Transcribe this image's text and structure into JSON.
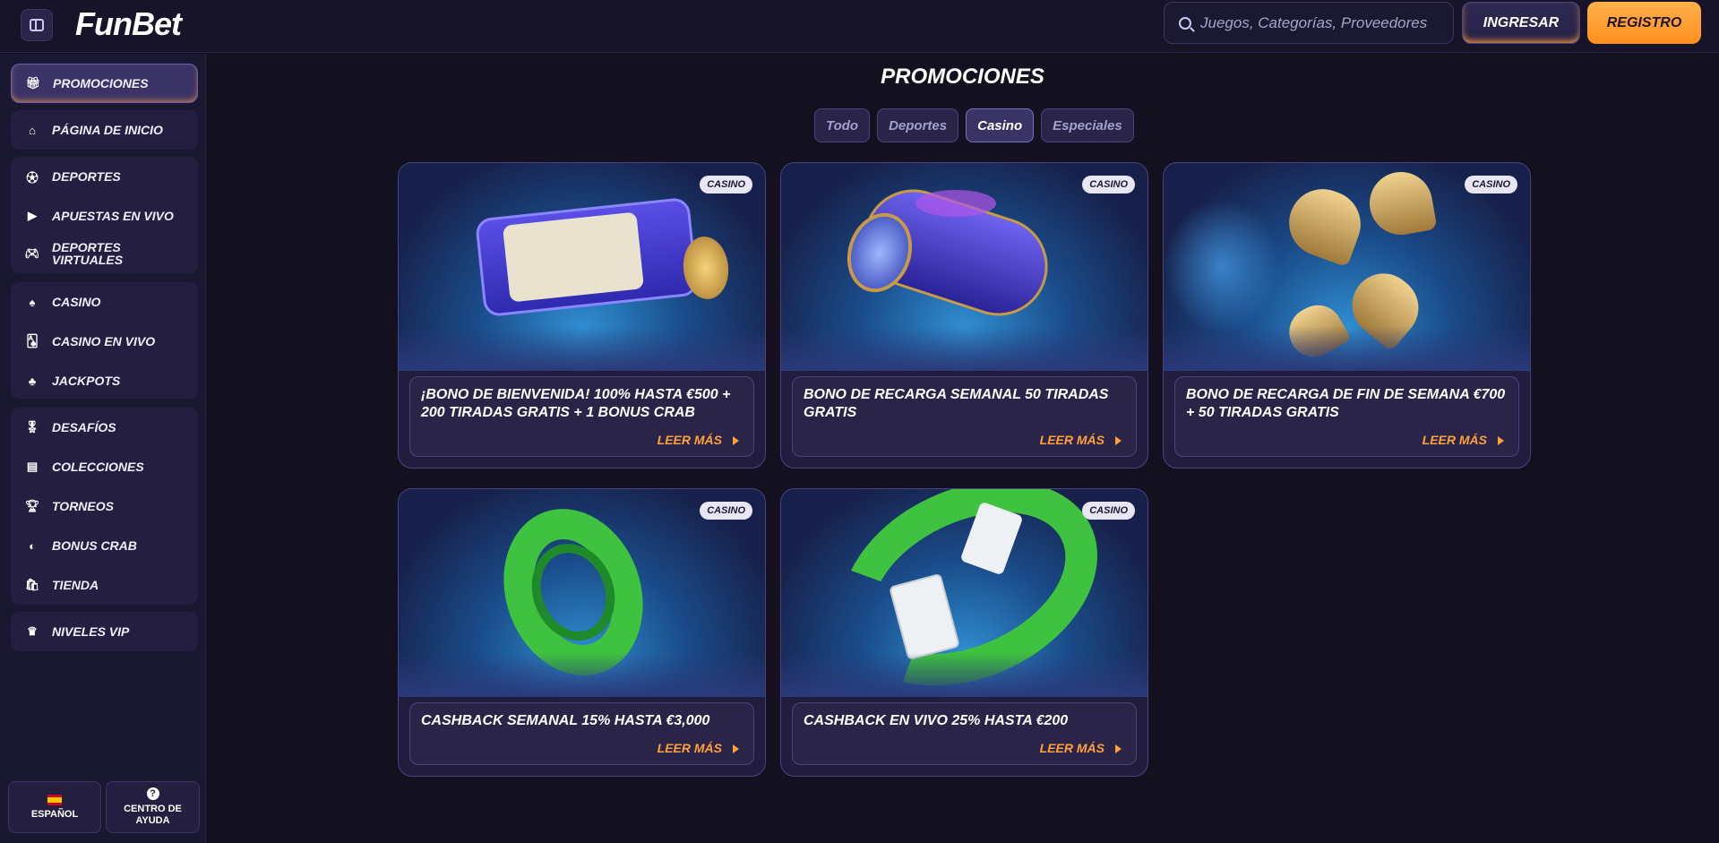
{
  "header": {
    "logo": "FunBet",
    "search_placeholder": "Juegos, Categorías, Proveedores",
    "login_label": "INGRESAR",
    "register_label": "REGISTRO"
  },
  "sidebar": {
    "items": [
      {
        "label": "PROMOCIONES",
        "icon": "gift-icon"
      },
      {
        "label": "PÁGINA DE INICIO",
        "icon": "home-icon"
      },
      {
        "label": "DEPORTES",
        "icon": "soccer-ball-icon"
      },
      {
        "label": "APUESTAS EN VIVO",
        "icon": "live-play-icon"
      },
      {
        "label": "DEPORTES VIRTUALES",
        "icon": "gamepad-icon"
      },
      {
        "label": "CASINO",
        "icon": "casino-icon"
      },
      {
        "label": "CASINO EN VIVO",
        "icon": "cards-icon"
      },
      {
        "label": "JACKPOTS",
        "icon": "clover-icon"
      },
      {
        "label": "DESAFÍOS",
        "icon": "medal-icon"
      },
      {
        "label": "COLECCIONES",
        "icon": "collection-icon"
      },
      {
        "label": "TORNEOS",
        "icon": "trophy-icon"
      },
      {
        "label": "BONUS CRAB",
        "icon": "crab-icon"
      },
      {
        "label": "TIENDA",
        "icon": "shop-icon"
      },
      {
        "label": "NIVELES VIP",
        "icon": "crown-icon"
      }
    ],
    "language_label": "ESPAÑOL",
    "help_label": "CENTRO DE AYUDA"
  },
  "main": {
    "title": "PROMOCIONES",
    "tabs": [
      "Todo",
      "Deportes",
      "Casino",
      "Especiales"
    ],
    "active_tab": "Casino",
    "read_more": "LEER MÁS",
    "cards": [
      {
        "badge": "CASINO",
        "title": "¡BONO DE BIENVENIDA! 100% HASTA €500 + 200 TIRADAS GRATIS + 1 BONUS CRAB"
      },
      {
        "badge": "CASINO",
        "title": "BONO DE RECARGA SEMANAL 50 TIRADAS GRATIS"
      },
      {
        "badge": "CASINO",
        "title": "BONO DE RECARGA DE FIN DE SEMANA €700 + 50 TIRADAS GRATIS"
      },
      {
        "badge": "CASINO",
        "title": "CASHBACK SEMANAL 15% HASTA €3,000"
      },
      {
        "badge": "CASINO",
        "title": "CASHBACK EN VIVO 25% HASTA €200"
      }
    ]
  },
  "colors": {
    "accent": "#ffa03a",
    "background": "#13111f",
    "panel": "#241f40"
  }
}
